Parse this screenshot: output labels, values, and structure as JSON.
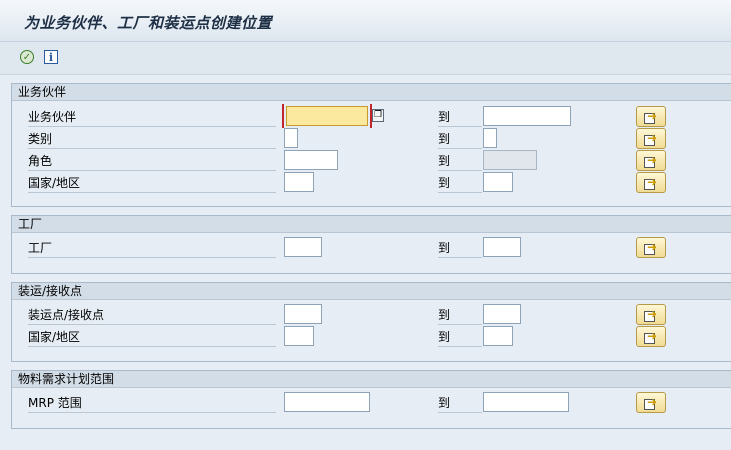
{
  "window": {
    "title": "为业务伙伴、工厂和装运点创建位置"
  },
  "toolbar": {
    "execute_icon": "execute-icon",
    "info_icon": "info-icon",
    "info_glyph": "i"
  },
  "groups": {
    "partner": {
      "header": "业务伙伴",
      "rows": [
        {
          "label": "业务伙伴",
          "to": "到",
          "from_value": "",
          "to_value": ""
        },
        {
          "label": "类别",
          "to": "到",
          "from_value": "",
          "to_value": ""
        },
        {
          "label": "角色",
          "to": "到",
          "from_value": "",
          "to_value": ""
        },
        {
          "label": "国家/地区",
          "to": "到",
          "from_value": "",
          "to_value": ""
        }
      ]
    },
    "plant": {
      "header": "工厂",
      "rows": [
        {
          "label": "工厂",
          "to": "到",
          "from_value": "",
          "to_value": ""
        }
      ]
    },
    "shipping": {
      "header": "装运/接收点",
      "rows": [
        {
          "label": "装运点/接收点",
          "to": "到",
          "from_value": "",
          "to_value": ""
        },
        {
          "label": "国家/地区",
          "to": "到",
          "from_value": "",
          "to_value": ""
        }
      ]
    },
    "mrp": {
      "header": "物料需求计划范围",
      "rows": [
        {
          "label": "MRP 范围",
          "to": "到",
          "from_value": "",
          "to_value": ""
        }
      ]
    }
  },
  "colors": {
    "background": "#e6edf4",
    "focus_field": "#fbe9a0",
    "button_fill": "#f0dc93"
  }
}
